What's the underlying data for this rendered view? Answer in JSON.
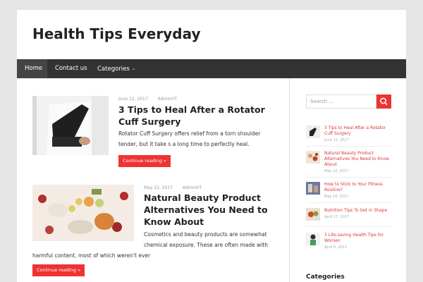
{
  "site": {
    "title": "Health Tips Everyday"
  },
  "nav": {
    "items": [
      {
        "label": "Home"
      },
      {
        "label": "Contact us"
      },
      {
        "label": "Categories"
      }
    ]
  },
  "posts": [
    {
      "date": "June 12, 2017",
      "author": "AdminHT",
      "title_line1": "3 Tips to Heal After a Rotator",
      "title_line2": "Cuff Surgery",
      "excerpt_line1": "Rotator Cuff Surgery offers relief from a torn shoulder",
      "excerpt_line2": "tender, but it take s a long time to perfectly heal.",
      "button": "Continue reading »"
    },
    {
      "date": "May 22, 2017",
      "author": "AdminHT",
      "title_line1": "Natural Beauty Product",
      "title_line2": "Alternatives You Need to",
      "title_line3": "Know About",
      "excerpt_line1": "Cosmetics and beauty products are somewhat",
      "excerpt_line2": "chemical exposure. These are often made with",
      "excerpt_line3": "harmful content, most of which weren't ever",
      "button": "Continue reading »"
    }
  ],
  "sidebar": {
    "search_placeholder": "Search ...",
    "recent": [
      {
        "title": "3 Tips to Heal After a Rotator Cuff Surgery",
        "date": "June 12, 2017"
      },
      {
        "title": "Natural Beauty Product Alternatives You Need to Know About",
        "date": "May 22, 2017"
      },
      {
        "title": "How to Stick to Your Fitness Routine?",
        "date": "May 10, 2017"
      },
      {
        "title": "Nutrition Tips To Get in Shape",
        "date": "April 17, 2017"
      },
      {
        "title": "3 Life-saving Health Tips for Women",
        "date": "April 6, 2017"
      }
    ],
    "categories_title": "Categories"
  },
  "colors": {
    "accent": "#e33333",
    "nav_bg": "#333333"
  }
}
